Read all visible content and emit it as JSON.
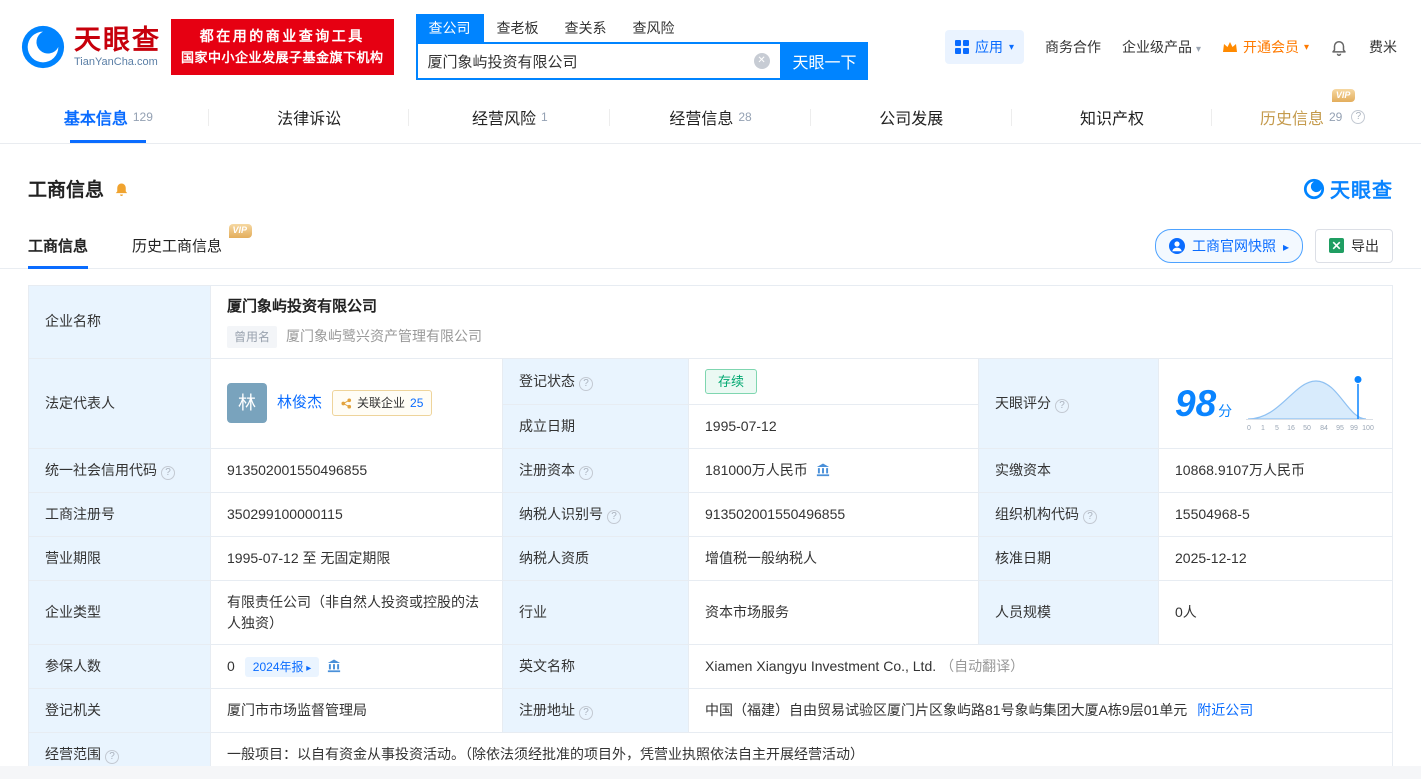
{
  "header": {
    "logo": {
      "name": "天眼查",
      "domain": "TianYanCha.com"
    },
    "banner": {
      "line1": "都在用的商业查询工具",
      "line2": "国家中小企业发展子基金旗下机构"
    },
    "search": {
      "tabs": [
        {
          "label": "查公司"
        },
        {
          "label": "查老板"
        },
        {
          "label": "查关系"
        },
        {
          "label": "查风险"
        }
      ],
      "value": "厦门象屿投资有限公司",
      "button": "天眼一下"
    },
    "nav": {
      "apps": "应用",
      "cooperation": "商务合作",
      "enterprise": "企业级产品",
      "vip": "开通会员",
      "user": "费米"
    }
  },
  "vip_badge_text": "VIP",
  "tabs": [
    {
      "label": "基本信息",
      "count": "129"
    },
    {
      "label": "法律诉讼",
      "count": ""
    },
    {
      "label": "经营风险",
      "count": "1"
    },
    {
      "label": "经营信息",
      "count": "28"
    },
    {
      "label": "公司发展",
      "count": ""
    },
    {
      "label": "知识产权",
      "count": ""
    },
    {
      "label": "历史信息",
      "count": "29"
    }
  ],
  "section": {
    "title": "工商信息",
    "logo": "天眼查",
    "subtabs": [
      {
        "label": "工商信息"
      },
      {
        "label": "历史工商信息"
      }
    ],
    "snapshot_button": "工商官网快照",
    "export_button": "导出"
  },
  "info": {
    "company_name_label": "企业名称",
    "company_name": "厦门象屿投资有限公司",
    "former_name_badge": "曾用名",
    "former_name": "厦门象屿鹭兴资产管理有限公司",
    "legal_rep_label": "法定代表人",
    "legal_rep_avatar": "林",
    "legal_rep_name": "林俊杰",
    "related_companies_label": "关联企业",
    "related_companies_count": "25",
    "reg_status_label": "登记状态",
    "reg_status": "存续",
    "establish_date_label": "成立日期",
    "establish_date": "1995-07-12",
    "score_label": "天眼评分",
    "credit_code_label": "统一社会信用代码",
    "credit_code": "913502001550496855",
    "reg_capital_label": "注册资本",
    "reg_capital": "181000万人民币",
    "paid_capital_label": "实缴资本",
    "paid_capital": "10868.9107万人民币",
    "reg_number_label": "工商注册号",
    "reg_number": "350299100000115",
    "taxpayer_id_label": "纳税人识别号",
    "taxpayer_id": "913502001550496855",
    "org_code_label": "组织机构代码",
    "org_code": "15504968-5",
    "business_term_label": "营业期限",
    "business_term": "1995-07-12 至 无固定期限",
    "taxpayer_quality_label": "纳税人资质",
    "taxpayer_quality": "增值税一般纳税人",
    "approval_date_label": "核准日期",
    "approval_date": "2025-12-12",
    "company_type_label": "企业类型",
    "company_type": "有限责任公司（非自然人投资或控股的法人独资）",
    "industry_label": "行业",
    "industry": "资本市场服务",
    "staff_size_label": "人员规模",
    "staff_size": "0人",
    "insured_label": "参保人数",
    "insured": "0",
    "annual_report_badge": "2024年报",
    "english_name_label": "英文名称",
    "english_name": "Xiamen Xiangyu Investment Co., Ltd.",
    "english_name_note": "（自动翻译）",
    "reg_authority_label": "登记机关",
    "reg_authority": "厦门市市场监督管理局",
    "address_label": "注册地址",
    "address": "中国（福建）自由贸易试验区厦门片区象屿路81号象屿集团大厦A栋9层01单元",
    "nearby_link": "附近公司",
    "business_scope_label": "经营范围",
    "business_scope": "一般项目：以自有资金从事投资活动。（除依法须经批准的项目外，凭营业执照依法自主开展经营活动）"
  },
  "score_chart": {
    "type": "area",
    "score": "98",
    "unit": "分",
    "ticks": [
      "0",
      "1",
      "5",
      "16",
      "50",
      "84",
      "95",
      "99",
      "100"
    ]
  }
}
